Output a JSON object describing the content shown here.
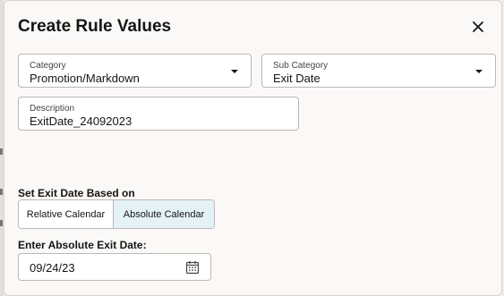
{
  "dialog": {
    "title": "Create Rule Values"
  },
  "category": {
    "label": "Category",
    "value": "Promotion/Markdown"
  },
  "sub_category": {
    "label": "Sub Category",
    "value": "Exit Date"
  },
  "description": {
    "label": "Description",
    "value": "ExitDate_24092023"
  },
  "exit_date_basis": {
    "label": "Set Exit Date Based on",
    "options": [
      "Relative Calendar",
      "Absolute Calendar"
    ],
    "selected": "Absolute Calendar"
  },
  "absolute_exit_date": {
    "label": "Enter Absolute Exit Date:",
    "value": "09/24/23"
  },
  "icons": {
    "close": "close-icon",
    "dropdown": "chevron-down-icon",
    "calendar": "calendar-icon"
  },
  "colors": {
    "selected_segment": "#e4f1f7",
    "dialog_background": "#fbf9f8"
  }
}
